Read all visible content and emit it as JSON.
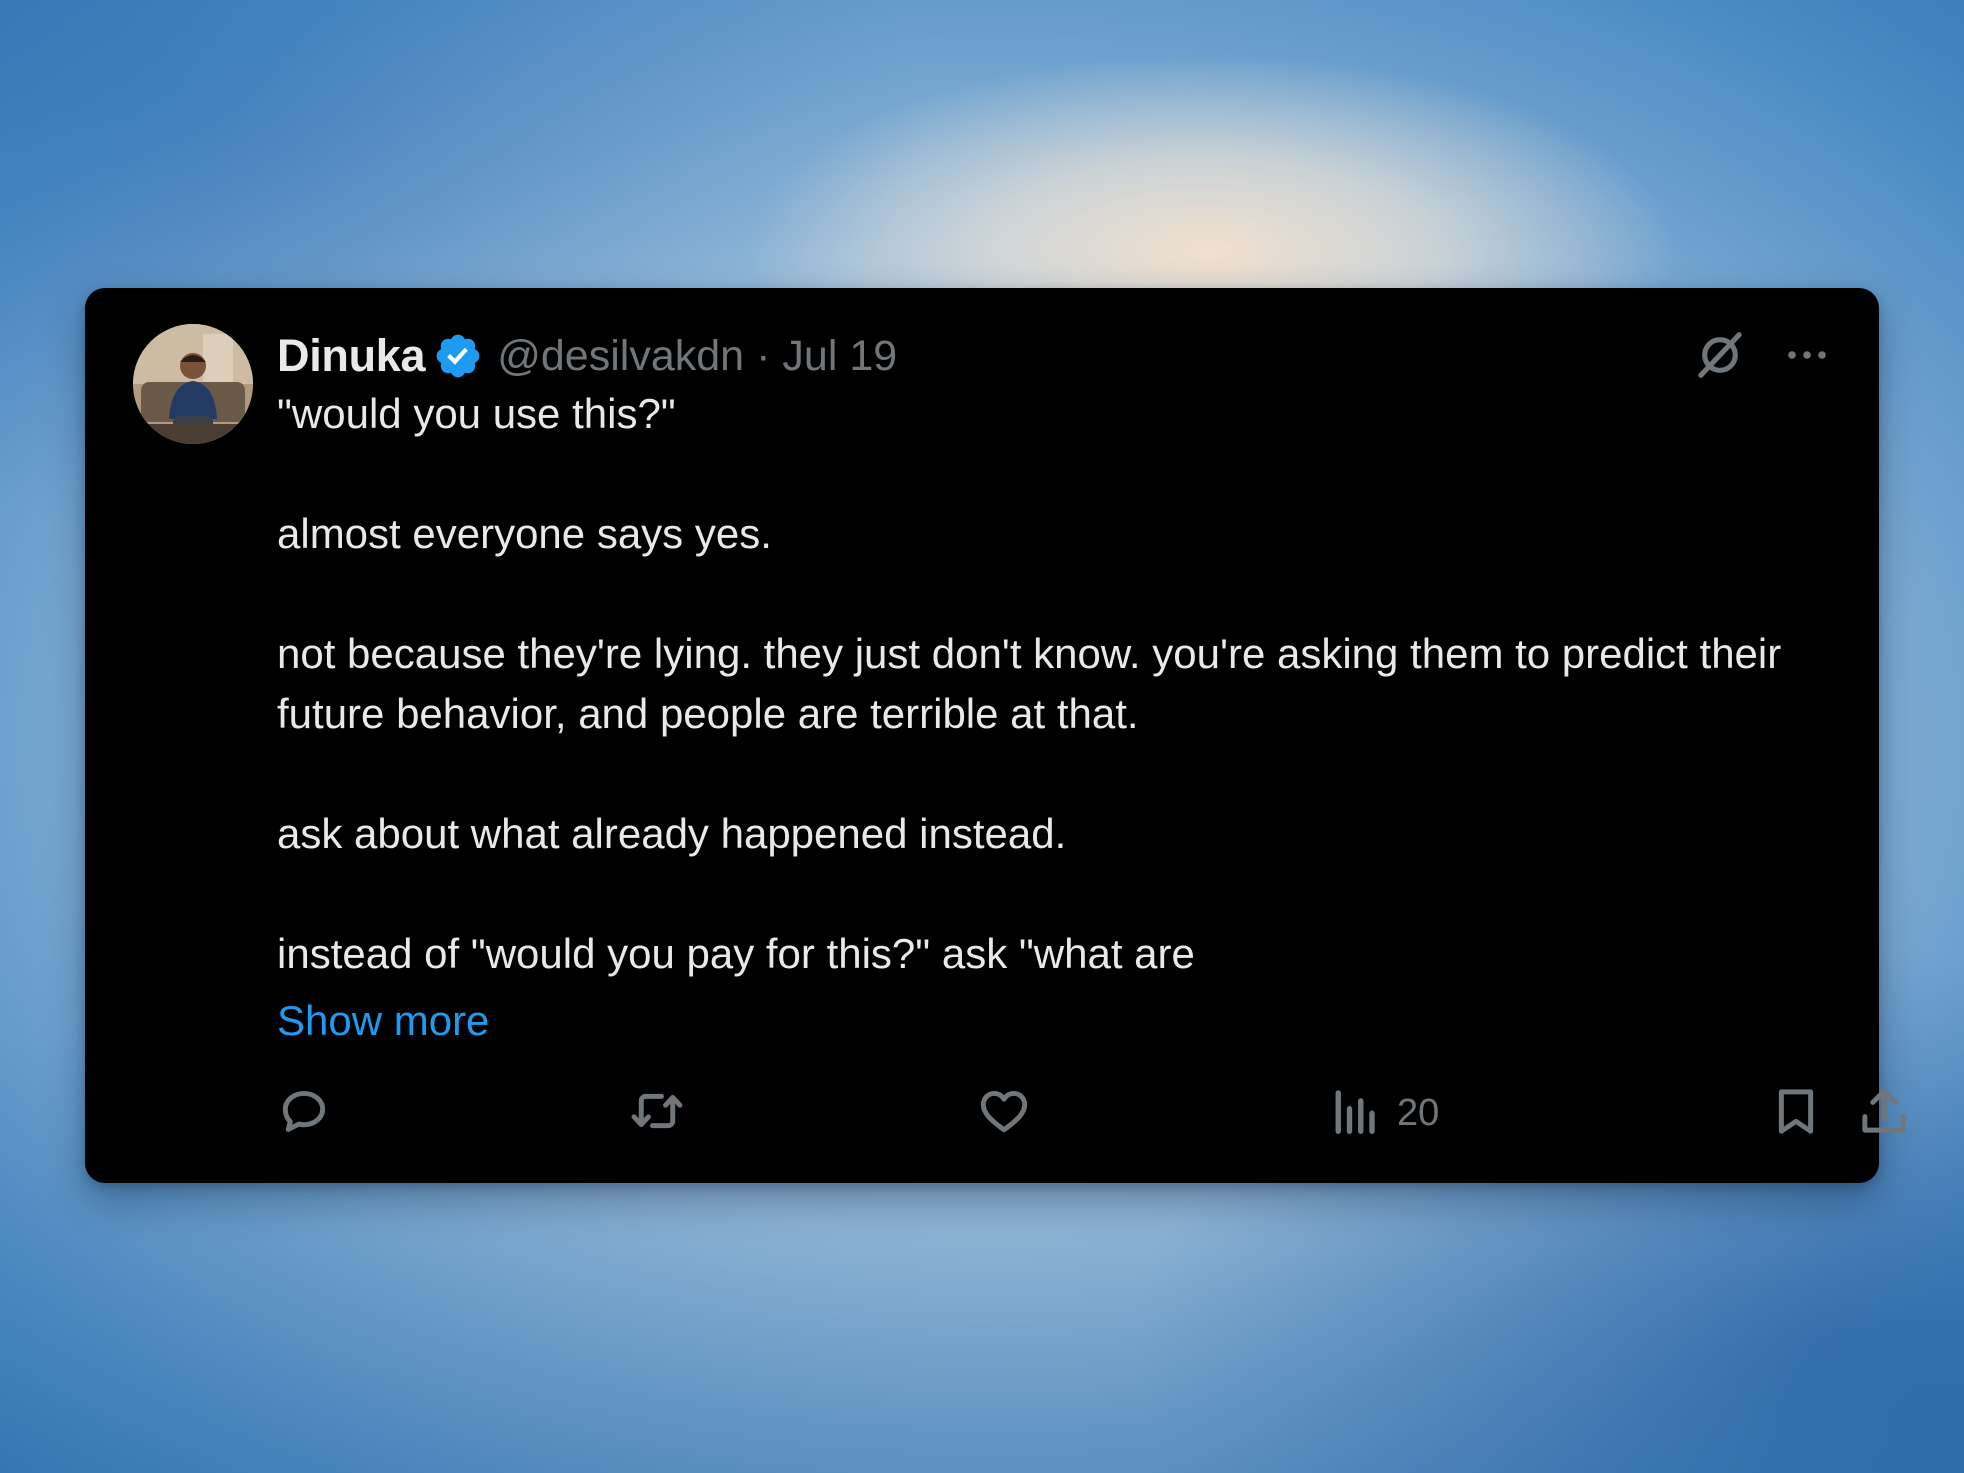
{
  "tweet": {
    "display_name": "Dinuka",
    "handle": "@desilvakdn",
    "separator": "·",
    "date": "Jul 19",
    "verified": true,
    "lines": [
      "\"would you use this?\"",
      "almost everyone says yes.",
      "not because they're lying. they just don't know. you're asking them to predict their future behavior, and people are terrible at that.",
      "ask about what already happened instead.",
      "instead of \"would you pay for this?\" ask \"what are"
    ],
    "show_more": "Show more",
    "views_count": "20"
  },
  "icons": {
    "verified": "verified-badge-icon",
    "grok": "grok-icon",
    "more": "more-dots-icon",
    "reply": "reply-icon",
    "retweet": "retweet-icon",
    "like": "heart-icon",
    "views": "views-icon",
    "bookmark": "bookmark-icon",
    "share": "share-icon"
  },
  "colors": {
    "card_background": "#000000",
    "text_primary": "#e7e9ea",
    "text_secondary": "#71767b",
    "accent": "#1d9bf0"
  }
}
